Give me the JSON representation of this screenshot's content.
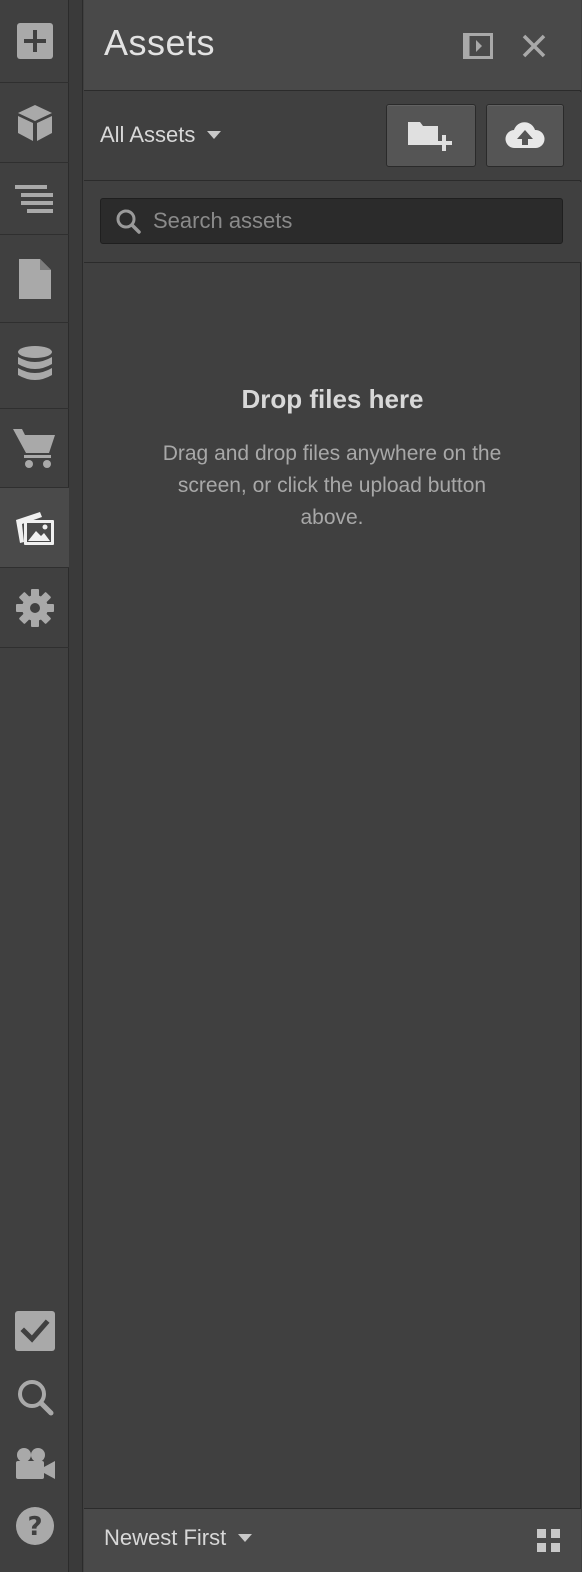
{
  "panel": {
    "title": "Assets"
  },
  "toolbar": {
    "filter_label": "All Assets"
  },
  "search": {
    "placeholder": "Search assets",
    "value": ""
  },
  "drop_zone": {
    "title": "Drop files here",
    "description": "Drag and drop files anywhere on the screen, or click the upload button above."
  },
  "footer": {
    "sort_label": "Newest First"
  },
  "rail": {
    "top_items": [
      {
        "icon": "add-icon"
      },
      {
        "icon": "cube-icon"
      },
      {
        "icon": "navigator-icon"
      },
      {
        "icon": "page-icon"
      },
      {
        "icon": "database-icon"
      },
      {
        "icon": "cart-icon"
      },
      {
        "icon": "assets-icon",
        "active": true
      },
      {
        "icon": "gear-icon"
      }
    ],
    "bottom_items": [
      {
        "icon": "checkbox-icon"
      },
      {
        "icon": "search-icon"
      },
      {
        "icon": "video-camera-icon"
      },
      {
        "icon": "help-icon"
      }
    ]
  },
  "colors": {
    "background": "#404040",
    "header": "#494949",
    "icon": "#a9a9a9",
    "text": "#d8d8d8",
    "muted_text": "#a8a8a8"
  }
}
